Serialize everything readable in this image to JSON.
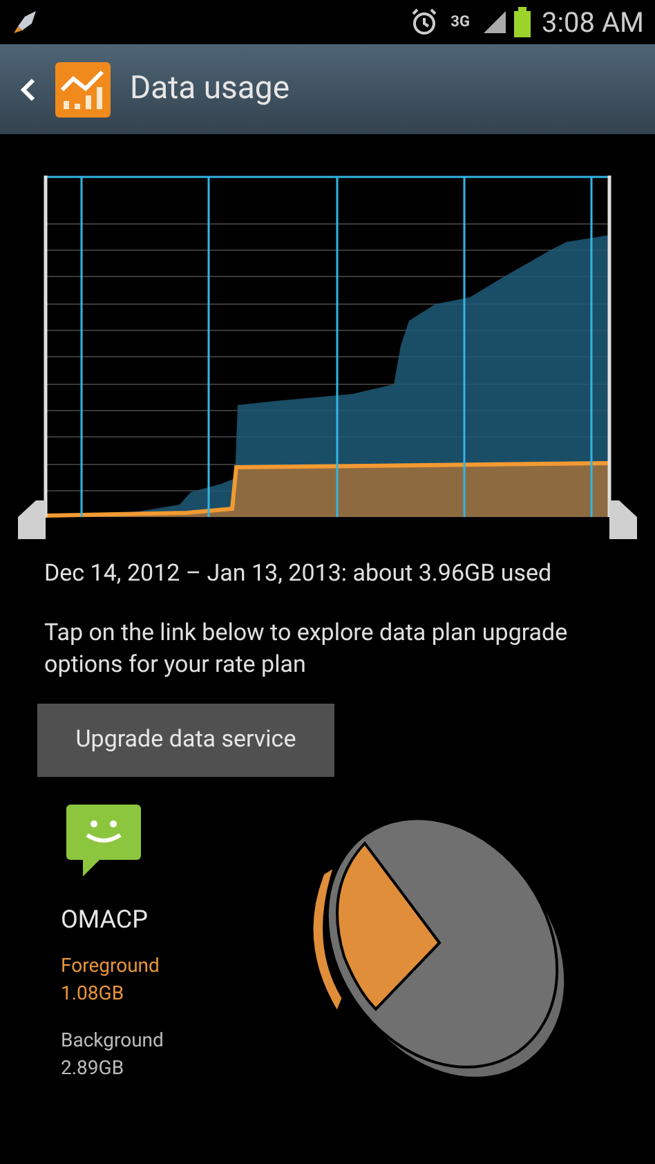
{
  "status_bar": {
    "network": "3G",
    "time": "3:08 AM"
  },
  "header": {
    "title": "Data usage"
  },
  "usage_summary": "Dec 14, 2012 – Jan 13, 2013: about 3.96GB used",
  "note": "Tap on the link below to explore data plan upgrade options for your rate plan",
  "upgrade_button": "Upgrade data service",
  "app": {
    "name": "OMACP",
    "foreground_label": "Foreground",
    "foreground_value": "1.08GB",
    "background_label": "Background",
    "background_value": "2.89GB"
  }
}
